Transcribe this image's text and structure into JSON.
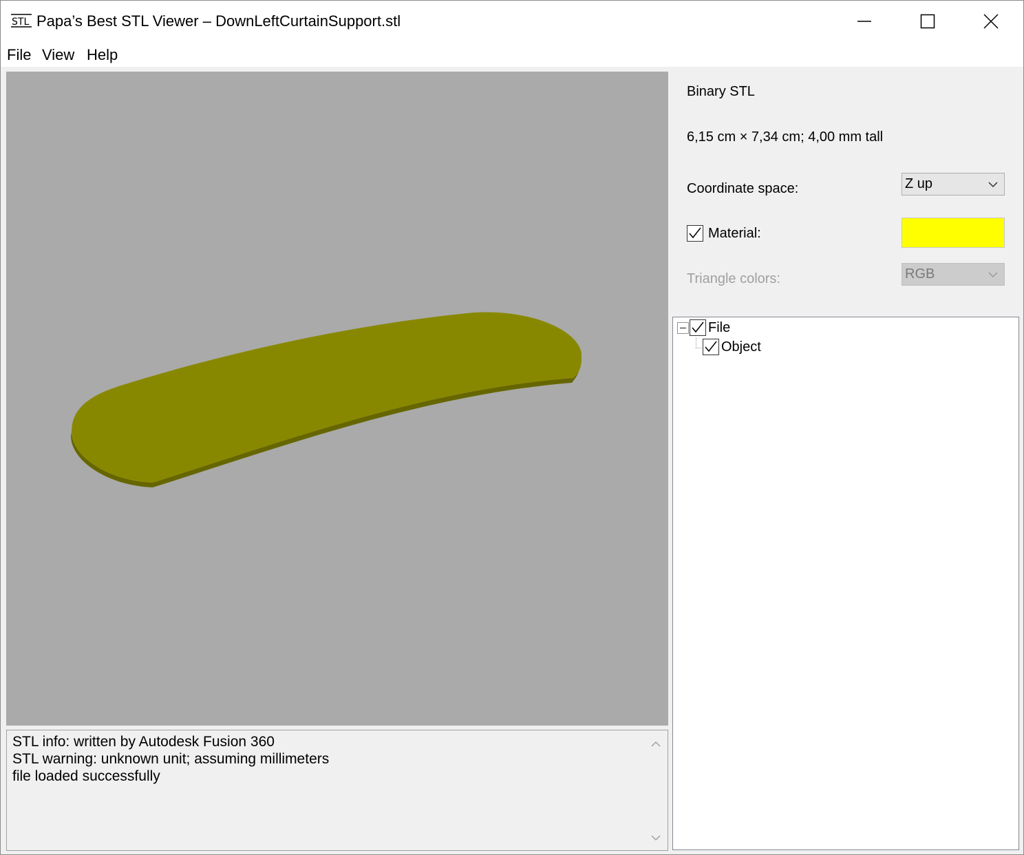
{
  "window": {
    "title": "Papa’s Best STL Viewer – DownLeftCurtainSupport.stl",
    "app_icon_text": "STL",
    "controls": [
      "minimize-icon",
      "maximize-icon",
      "close-icon"
    ]
  },
  "menu": {
    "items": [
      "File",
      "View",
      "Help"
    ]
  },
  "viewport": {
    "background_color": "#aaaaaa",
    "model_top_color": "#888800",
    "model_edge_color": "#666600"
  },
  "log": {
    "lines": [
      "STL info: written by Autodesk Fusion 360",
      "STL warning: unknown unit; assuming millimeters",
      "file loaded successfully"
    ]
  },
  "panel": {
    "format": "Binary STL",
    "dimensions": "6,15 cm × 7,34 cm; 4,00 mm tall",
    "coordinate_space_label": "Coordinate space:",
    "coordinate_space_value": "Z up",
    "material_label": "Material:",
    "material_checked": true,
    "material_color": "#ffff00",
    "triangle_colors_label": "Triangle colors:",
    "triangle_colors_value": "RGB",
    "triangle_colors_enabled": false
  },
  "tree": {
    "root": {
      "label": "File",
      "checked": true,
      "expanded": true
    },
    "children": [
      {
        "label": "Object",
        "checked": true
      }
    ]
  }
}
